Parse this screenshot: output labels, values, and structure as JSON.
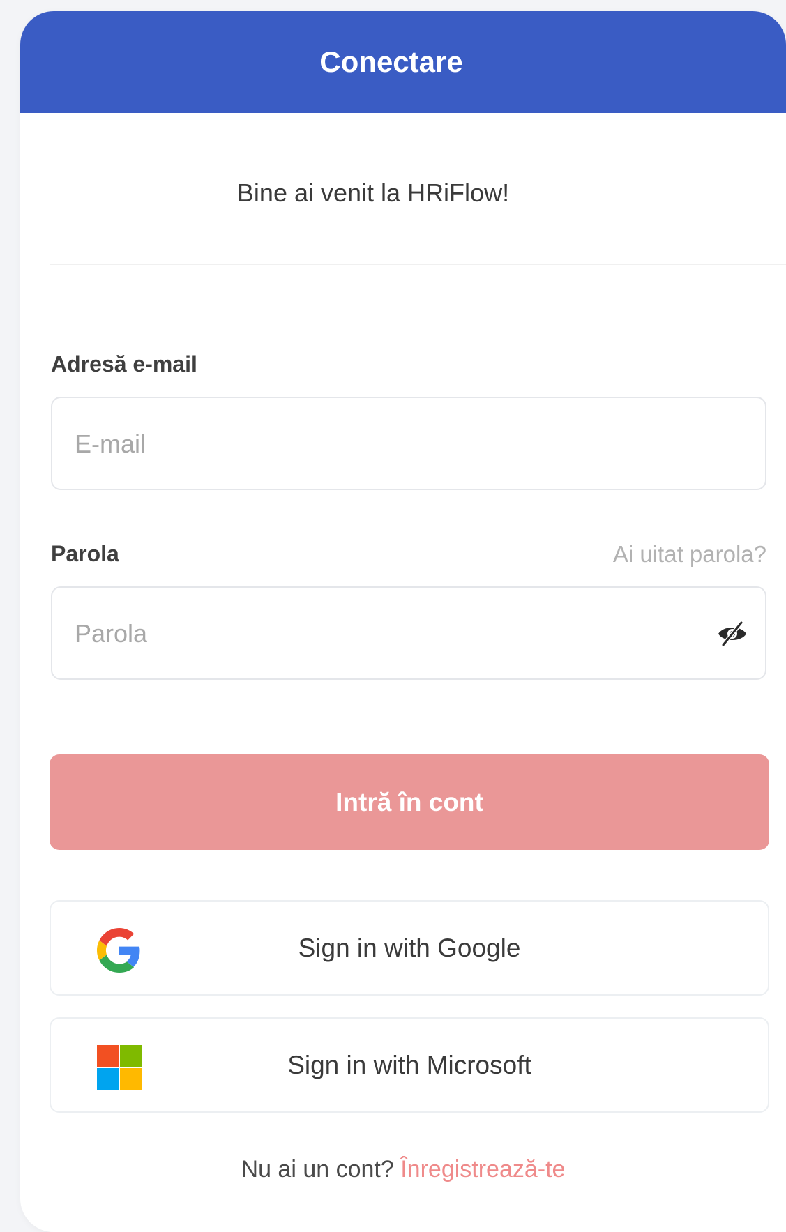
{
  "header": {
    "title": "Conectare"
  },
  "welcome": "Bine ai venit la HRiFlow!",
  "email": {
    "label": "Adresă e-mail",
    "placeholder": "E-mail",
    "value": ""
  },
  "password": {
    "label": "Parola",
    "placeholder": "Parola",
    "value": "",
    "forgot_label": "Ai uitat parola?",
    "toggle_icon": "eye-slash-icon"
  },
  "login_button": {
    "label": "Intră în cont",
    "color": "#ea9797"
  },
  "social": {
    "google": {
      "label": "Sign in with Google",
      "icon": "google-icon"
    },
    "microsoft": {
      "label": "Sign in with Microsoft",
      "icon": "microsoft-icon"
    }
  },
  "footer": {
    "text": "Nu ai un cont?",
    "link": "Înregistrează-te"
  },
  "colors": {
    "header_bg": "#3a5cc4",
    "link": "#ef8a8a"
  }
}
